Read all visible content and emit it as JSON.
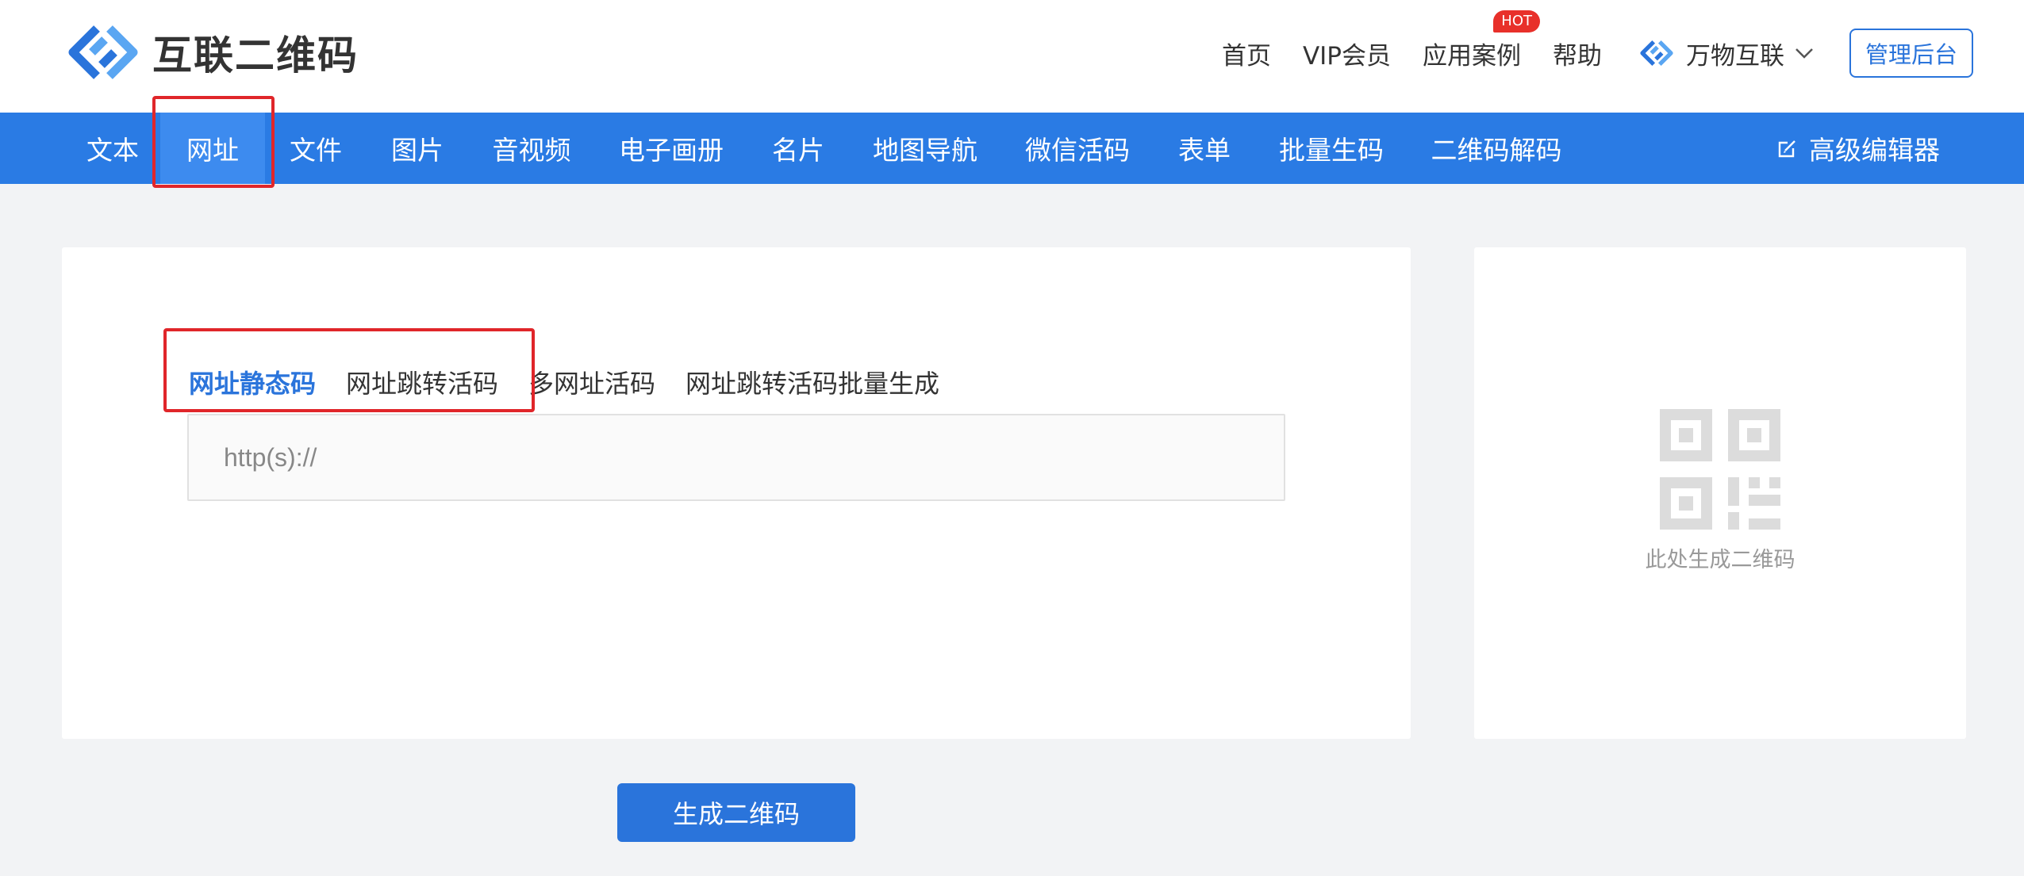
{
  "brand": {
    "name": "互联二维码",
    "logo_icon": "chain-link-logo-icon",
    "color": "#2a74db"
  },
  "topnav": {
    "items": [
      "首页",
      "VIP会员",
      "应用案例",
      "帮助"
    ],
    "hot_badge": "HOT",
    "brand_switch": "万物互联",
    "admin_button": "管理后台"
  },
  "categories": {
    "items": [
      "文本",
      "网址",
      "文件",
      "图片",
      "音视频",
      "电子画册",
      "名片",
      "地图导航",
      "微信活码",
      "表单",
      "批量生码",
      "二维码解码"
    ],
    "active_index": 1,
    "advanced_editor": "高级编辑器",
    "bar_color": "#2a7be4"
  },
  "editor": {
    "subtabs": [
      "网址静态码",
      "网址跳转活码",
      "多网址活码",
      "网址跳转活码批量生成"
    ],
    "active_subtab": 0,
    "url_placeholder": "http(s)://",
    "url_value": ""
  },
  "preview": {
    "caption": "此处生成二维码",
    "icon": "qr-code-placeholder-icon"
  },
  "actions": {
    "generate": "生成二维码"
  }
}
